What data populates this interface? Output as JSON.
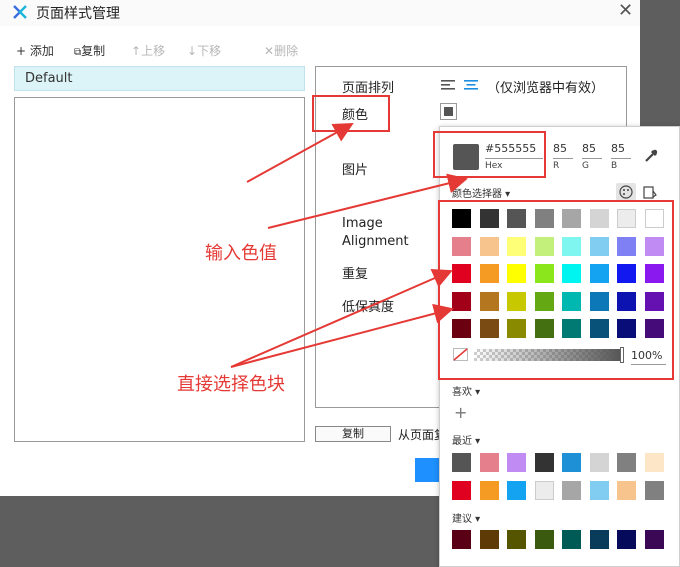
{
  "window": {
    "title": "页面样式管理",
    "close_glyph": "✕"
  },
  "toolbar": {
    "add": "+ 添加",
    "copy": "复制",
    "up": "上移",
    "down": "下移",
    "delete": "删除"
  },
  "style_list": {
    "items": [
      "Default"
    ]
  },
  "props": {
    "arrange_label": "页面排列",
    "browser_note": "（仅浏览器中有效）",
    "color_label": "颜色",
    "image_label": "图片",
    "image_alignment_label": [
      "Image",
      "Alignment"
    ],
    "repeat_label": "重复",
    "fidelity_label": "低保真度"
  },
  "bottom": {
    "copy_button": "复制",
    "copy_from": "从页面复"
  },
  "picker": {
    "current_hex": "#555555",
    "hex_label": "Hex",
    "r": "85",
    "g": "85",
    "b": "85",
    "r_label": "R",
    "g_label": "G",
    "b_label": "B",
    "selector_label": "颜色选择器 ▾",
    "opacity": "100%",
    "favorites_label": "喜欢 ▾",
    "add_glyph": "+",
    "recent_label": "最近 ▾",
    "suggest_label": "建议 ▾",
    "palette_rows": [
      [
        "#000000",
        "#333333",
        "#555555",
        "#808080",
        "#a6a6a6",
        "#d4d4d4",
        "#ececec",
        "#ffffff"
      ],
      [
        "#e57f8b",
        "#f7c48e",
        "#ffff77",
        "#c3f07a",
        "#7ff6f0",
        "#80cdf1",
        "#8080f5",
        "#c18bf4"
      ],
      [
        "#e00020",
        "#f59a23",
        "#ffff00",
        "#8be71b",
        "#00f5f0",
        "#14a3f0",
        "#1219f0",
        "#8a19f0"
      ],
      [
        "#a20018",
        "#b57620",
        "#c8c800",
        "#64a813",
        "#00b8b0",
        "#0c78b8",
        "#0d13b0",
        "#6510b0"
      ],
      [
        "#6b0010",
        "#7a4c14",
        "#8a8a00",
        "#447012",
        "#007a73",
        "#08527a",
        "#090d78",
        "#450b78"
      ]
    ],
    "recent_rows": [
      [
        "#555555",
        "#e57f8b",
        "#c18bf4",
        "#333333",
        "#1e90d6",
        "#d4d4d4",
        "#808080",
        "#fde6c8"
      ],
      [
        "#e00020",
        "#f59a23",
        "#14a3f0",
        "#ececec",
        "#a6a6a6",
        "#80cdf1",
        "#f7c48e",
        "#808080"
      ]
    ],
    "suggest_row": [
      "#5a0016",
      "#5e3a06",
      "#555500",
      "#3a5a10",
      "#005a55",
      "#093c5a",
      "#050a5a",
      "#3a0855"
    ]
  },
  "annotations": {
    "input_value": "输入色值",
    "direct_pick": "直接选择色块"
  },
  "colors": {
    "accent_red": "#e53935",
    "primary_blue": "#1e90ff",
    "selected_row": "#dcf4f7"
  }
}
